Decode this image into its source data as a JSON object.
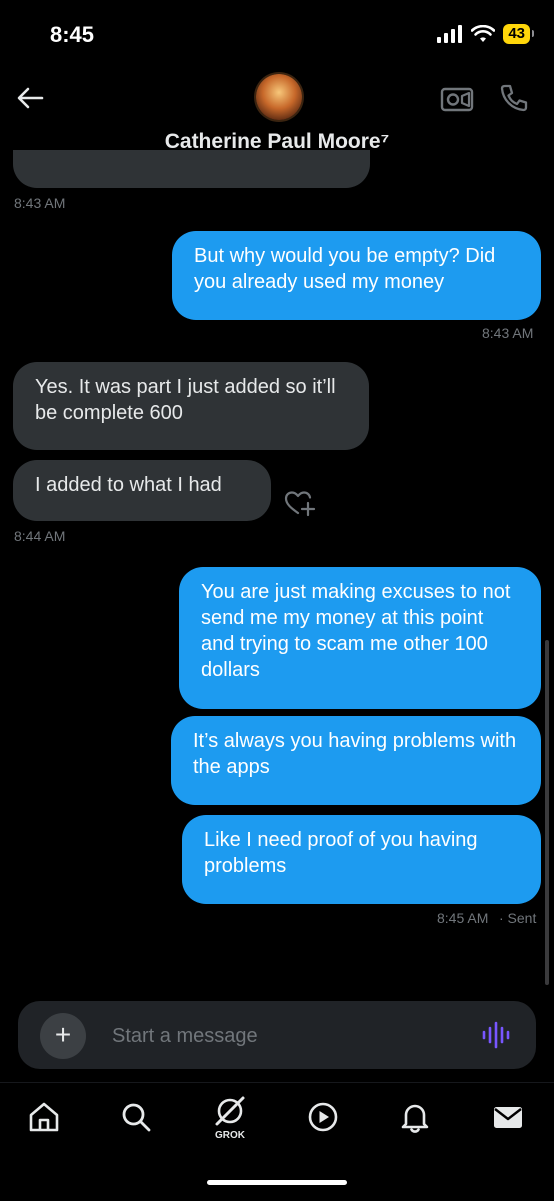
{
  "status": {
    "time": "8:45",
    "battery": "43"
  },
  "header": {
    "contact_name": "Catherine Paul Moore⁷"
  },
  "messages": [
    {
      "text": "But why would you be empty? Did you already used my money"
    },
    {
      "text": "Yes. It was part I just added so it’ll be complete 600"
    },
    {
      "text": "I added to what I had"
    },
    {
      "text": "You are just making excuses to not send me my money at this point and trying to scam me other 100 dollars"
    },
    {
      "text": "It’s always you having problems with the apps"
    },
    {
      "text": "Like I need proof of you having problems"
    }
  ],
  "timestamps": {
    "t1": "8:43 AM",
    "t2": "8:43 AM",
    "t3": "8:44 AM",
    "t4": "8:45 AM",
    "t4_status": "· Sent"
  },
  "composer": {
    "placeholder": "Start a message"
  },
  "nav": {
    "grok_label": "GROK"
  },
  "colors": {
    "accent": "#1d9bf0",
    "incoming_bubble": "#2f3336",
    "voice": "#7856ff",
    "battery": "#ffd60a"
  },
  "icons": [
    "back-arrow-icon",
    "video-icon",
    "phone-icon",
    "add-reaction-icon",
    "plus-icon",
    "voice-waveform-icon",
    "home-icon",
    "search-icon",
    "grok-icon",
    "play-icon",
    "bell-icon",
    "mail-icon"
  ]
}
